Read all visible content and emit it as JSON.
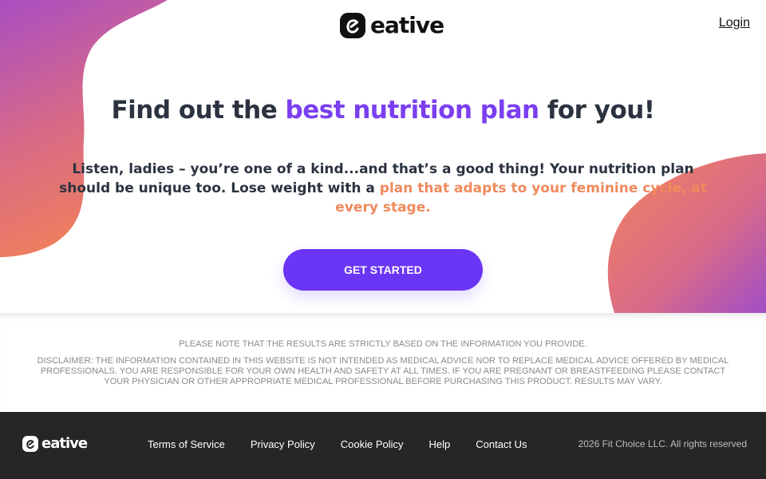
{
  "brand": {
    "name": "eative",
    "icon": "eative-logo-icon"
  },
  "header": {
    "login_label": "Login"
  },
  "hero": {
    "headline_pre": "Find out the ",
    "headline_accent": "best nutrition plan",
    "headline_post": " for you!",
    "sub_pre": "Listen, ladies – you’re one of a kind...and that’s a good thing! Your nutrition plan should be unique too. Lose weight with a ",
    "sub_accent": "plan that adapts to your feminine cycle, at every stage.",
    "cta_label": "GET STARTED"
  },
  "notice": {
    "note": "PLEASE NOTE THAT THE RESULTS ARE STRICTLY BASED ON THE INFORMATION YOU PROVIDE.",
    "disclaimer": "DISCLAIMER: THE INFORMATION CONTAINED IN THIS WEBSITE IS NOT INTENDED AS MEDICAL ADVICE NOR TO REPLACE MEDICAL ADVICE OFFERED BY MEDICAL PROFESSIONALS. YOU ARE RESPONSIBLE FOR YOUR OWN HEALTH AND SAFETY AT ALL TIMES. IF YOU ARE PREGNANT OR BREASTFEEDING PLEASE CONTACT YOUR PHYSICIAN OR OTHER APPROPRIATE MEDICAL PROFESSIONAL BEFORE PURCHASING THIS PRODUCT. RESULTS MAY VARY."
  },
  "footer": {
    "links": [
      "Terms of Service",
      "Privacy Policy",
      "Cookie Policy",
      "Help",
      "Contact Us"
    ],
    "copyright": "2026 Fit Choice LLC. All rights reserved"
  },
  "colors": {
    "accent_purple": "#7b3ff0",
    "accent_orange": "#f08a5d",
    "button": "#6b35f5",
    "footer_bg": "#262626",
    "text_dark": "#2b3340"
  }
}
